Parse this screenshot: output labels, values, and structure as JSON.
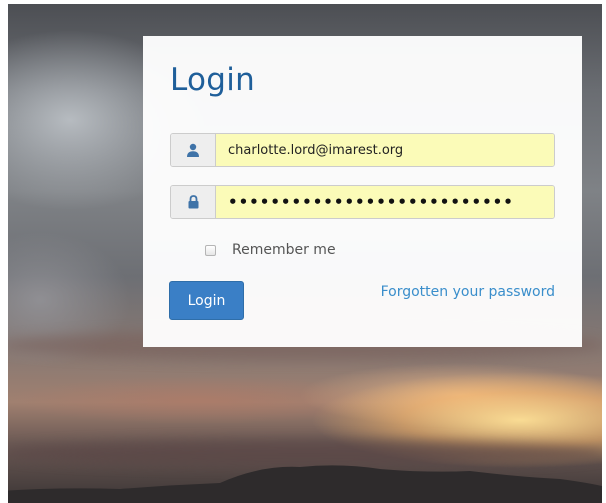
{
  "login": {
    "title": "Login",
    "email": {
      "value": "charlotte.lord@imarest.org",
      "icon": "user-icon"
    },
    "password": {
      "value": "•••••••••••••••••••••••••••",
      "icon": "lock-icon"
    },
    "remember_label": "Remember me",
    "remember_checked": false,
    "submit_label": "Login",
    "forgot_label": "Forgotten your password"
  },
  "colors": {
    "accent": "#3a7fc6",
    "title": "#1f5f9a",
    "link": "#3a8ecb",
    "autofill": "#fbfbb8",
    "icon": "#3f73a8"
  }
}
